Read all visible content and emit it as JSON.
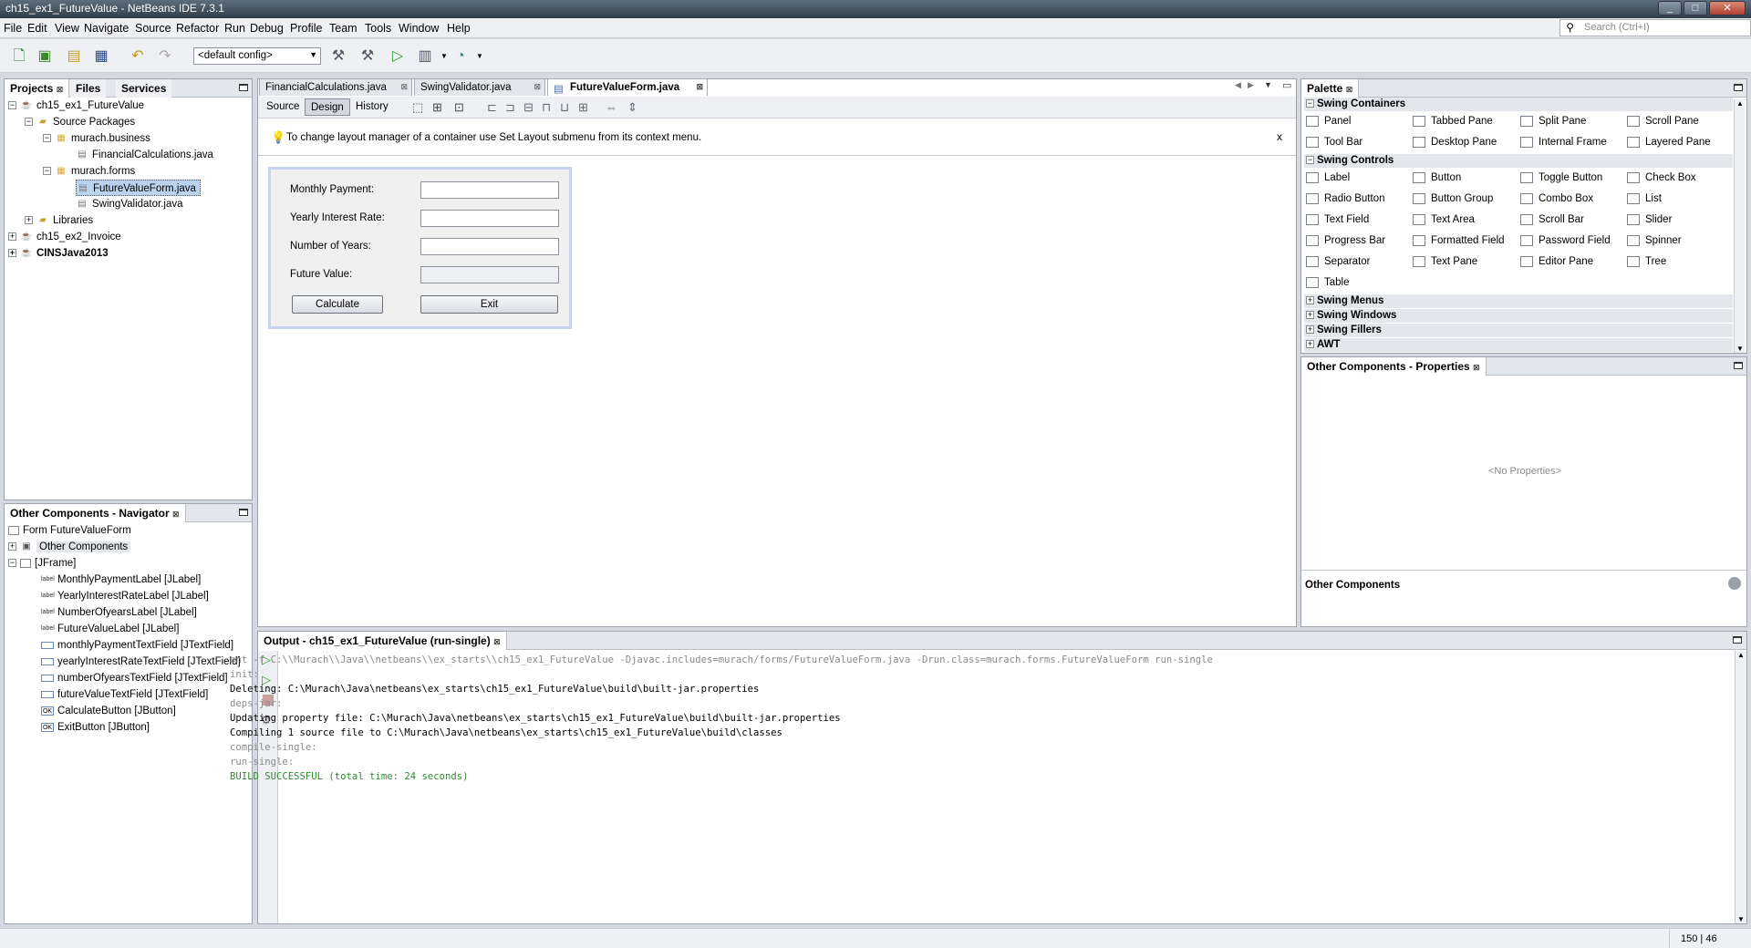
{
  "window": {
    "title": "ch15_ex1_FutureValue - NetBeans IDE 7.3.1"
  },
  "menu": [
    "File",
    "Edit",
    "View",
    "Navigate",
    "Source",
    "Refactor",
    "Run",
    "Debug",
    "Profile",
    "Team",
    "Tools",
    "Window",
    "Help"
  ],
  "search": {
    "placeholder": "Search (Ctrl+I)"
  },
  "toolbar": {
    "config": "<default config>"
  },
  "projects": {
    "tabs": [
      "Projects",
      "Files",
      "Services"
    ],
    "tree": [
      "ch15_ex1_FutureValue",
      "Source Packages",
      "murach.business",
      "FinancialCalculations.java",
      "murach.forms",
      "FutureValueForm.java",
      "SwingValidator.java",
      "Libraries",
      "ch15_ex2_Invoice",
      "CINSJava2013"
    ]
  },
  "navigator": {
    "title": "Other Components - Navigator",
    "items": [
      "Form FutureValueForm",
      "Other Components",
      "[JFrame]",
      "MonthlyPaymentLabel [JLabel]",
      "YearlyInterestRateLabel [JLabel]",
      "NumberOfyearsLabel [JLabel]",
      "FutureValueLabel [JLabel]",
      "monthlyPaymentTextField [JTextField]",
      "yearlyInterestRateTextField [JTextField]",
      "numberOfyearsTextField [JTextField]",
      "futureValueTextField [JTextField]",
      "CalculateButton [JButton]",
      "ExitButton [JButton]"
    ]
  },
  "editor": {
    "tabs": [
      "FinancialCalculations.java",
      "SwingValidator.java",
      "FutureValueForm.java"
    ],
    "modes": [
      "Source",
      "Design",
      "History"
    ],
    "hint": "To change layout manager of a container use Set Layout submenu from its context menu.",
    "hint_close": "x",
    "form": {
      "labels": [
        "Monthly Payment:",
        "Yearly Interest Rate:",
        "Number of Years:",
        "Future Value:"
      ],
      "buttons": {
        "calculate": "Calculate",
        "exit": "Exit"
      }
    }
  },
  "palette": {
    "title": "Palette",
    "sections": {
      "containers": "Swing Containers",
      "controls": "Swing Controls",
      "menus": "Swing Menus",
      "windows": "Swing Windows",
      "fillers": "Swing Fillers",
      "awt": "AWT"
    },
    "containers": [
      "Panel",
      "Tabbed Pane",
      "Split Pane",
      "Scroll Pane",
      "Tool Bar",
      "Desktop Pane",
      "Internal Frame",
      "Layered Pane"
    ],
    "controls": [
      "Label",
      "Button",
      "Toggle Button",
      "Check Box",
      "Radio Button",
      "Button Group",
      "Combo Box",
      "List",
      "Text Field",
      "Text Area",
      "Scroll Bar",
      "Slider",
      "Progress Bar",
      "Formatted Field",
      "Password Field",
      "Spinner",
      "Separator",
      "Text Pane",
      "Editor Pane",
      "Tree",
      "Table"
    ]
  },
  "properties": {
    "title": "Other Components - Properties",
    "empty": "<No Properties>",
    "footer": "Other Components"
  },
  "output": {
    "title": "Output - ch15_ex1_FutureValue (run-single)",
    "lines": [
      "ant -f C:\\\\Murach\\\\Java\\\\netbeans\\\\ex_starts\\\\ch15_ex1_FutureValue -Djavac.includes=murach/forms/FutureValueForm.java -Drun.class=murach.forms.FutureValueForm run-single",
      "init:",
      "Deleting: C:\\Murach\\Java\\netbeans\\ex_starts\\ch15_ex1_FutureValue\\build\\built-jar.properties",
      "deps-jar:",
      "Updating property file: C:\\Murach\\Java\\netbeans\\ex_starts\\ch15_ex1_FutureValue\\build\\built-jar.properties",
      "Compiling 1 source file to C:\\Murach\\Java\\netbeans\\ex_starts\\ch15_ex1_FutureValue\\build\\classes",
      "compile-single:",
      "run-single:",
      "BUILD SUCCESSFUL (total time: 24 seconds)"
    ]
  },
  "statusbar": {
    "position": "150 | 46"
  },
  "colors": {
    "success": "#2e8b2e",
    "gray_text": "#8a8a8a",
    "selection": "#bcd3ee"
  }
}
